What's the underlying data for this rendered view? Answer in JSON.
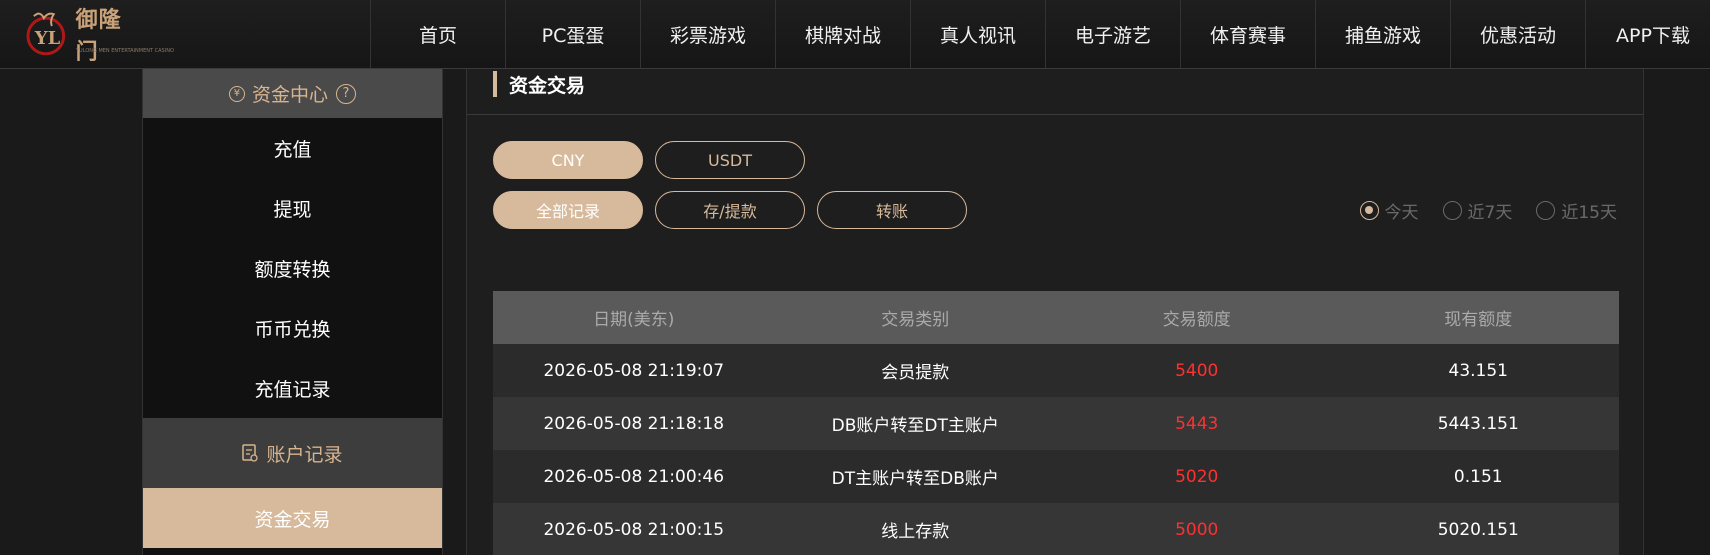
{
  "brand": {
    "name": "御隆门",
    "sub": "YULONG MEN ENTERTAINMENT CASINO"
  },
  "nav": [
    {
      "label": "首页"
    },
    {
      "label": "PC蛋蛋"
    },
    {
      "label": "彩票游戏"
    },
    {
      "label": "棋牌对战"
    },
    {
      "label": "真人视讯"
    },
    {
      "label": "电子游艺"
    },
    {
      "label": "体育赛事"
    },
    {
      "label": "捕鱼游戏"
    },
    {
      "label": "优惠活动"
    },
    {
      "label": "APP下载"
    }
  ],
  "sidebar": {
    "funds_head": "资金中心",
    "help_symbol": "?",
    "funds_items": [
      {
        "label": "充值"
      },
      {
        "label": "提现"
      },
      {
        "label": "额度转换"
      },
      {
        "label": "币币兑换"
      },
      {
        "label": "充值记录"
      }
    ],
    "account_head": "账户记录",
    "account_items": [
      {
        "label": "资金交易",
        "active": true
      }
    ]
  },
  "main": {
    "title": "资金交易",
    "currency_tabs": [
      {
        "label": "CNY",
        "active": true
      },
      {
        "label": "USDT",
        "active": false
      }
    ],
    "type_tabs": [
      {
        "label": "全部记录",
        "active": true
      },
      {
        "label": "存/提款",
        "active": false
      },
      {
        "label": "转账",
        "active": false
      }
    ],
    "range_options": [
      {
        "label": "今天",
        "checked": true
      },
      {
        "label": "近7天",
        "checked": false
      },
      {
        "label": "近15天",
        "checked": false
      }
    ],
    "table": {
      "headers": [
        "日期(美东)",
        "交易类别",
        "交易额度",
        "现有额度"
      ],
      "rows": [
        {
          "date": "2026-05-08 21:19:07",
          "type": "会员提款",
          "amount": "5400",
          "balance": "43.151"
        },
        {
          "date": "2026-05-08 21:18:18",
          "type": "DB账户转至DT主账户",
          "amount": "5443",
          "balance": "5443.151"
        },
        {
          "date": "2026-05-08 21:00:46",
          "type": "DT主账户转至DB账户",
          "amount": "5020",
          "balance": "0.151"
        },
        {
          "date": "2026-05-08 21:00:15",
          "type": "线上存款",
          "amount": "5000",
          "balance": "5020.151"
        }
      ]
    }
  },
  "colors": {
    "accent": "#d7b99b",
    "amount": "#ff3030",
    "header_bg": "#5a5a5a"
  }
}
